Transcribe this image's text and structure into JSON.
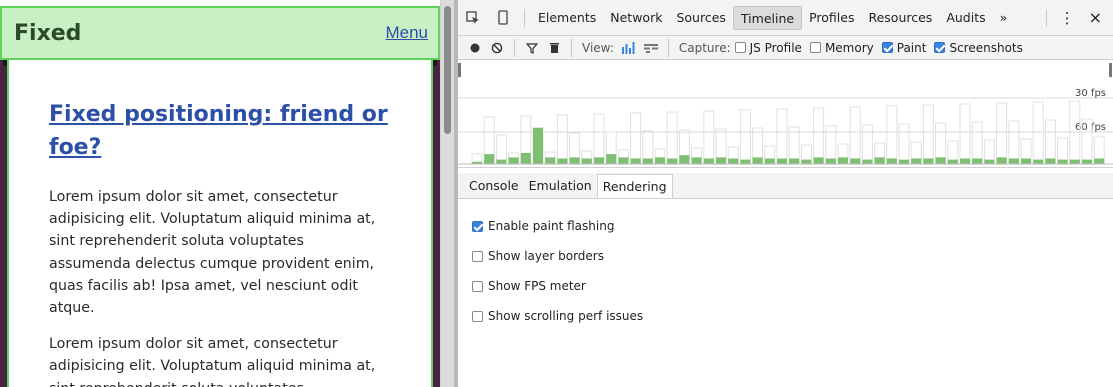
{
  "page": {
    "header_title": "Fixed",
    "menu_label": "Menu",
    "article_title": "Fixed positioning: friend or foe?",
    "paragraphs": [
      "Lorem ipsum dolor sit amet, consectetur\nadipisicing elit. Voluptatum aliquid minima at,\nsint reprehenderit soluta voluptates\nassumenda delectus cumque provident enim,\nquas facilis ab! Ipsa amet, vel nesciunt odit\natque.",
      "Lorem ipsum dolor sit amet, consectetur\nadipisicing elit. Voluptatum aliquid minima at,\nsint reprehenderit soluta voluptates"
    ]
  },
  "devtools": {
    "tabs": [
      "Elements",
      "Network",
      "Sources",
      "Timeline",
      "Profiles",
      "Resources",
      "Audits"
    ],
    "active_tab": "Timeline",
    "more_tabs": "»",
    "menu_dots": "⋮",
    "close": "×",
    "toolbar": {
      "view_label": "View:",
      "capture_label": "Capture:",
      "js_profile": {
        "label": "JS Profile",
        "checked": false
      },
      "memory": {
        "label": "Memory",
        "checked": false
      },
      "paint": {
        "label": "Paint",
        "checked": true
      },
      "screenshots": {
        "label": "Screenshots",
        "checked": true
      }
    },
    "overview": {
      "fps30_label": "30 fps",
      "fps60_label": "60 fps",
      "frames": [
        2,
        9,
        4,
        6,
        10,
        33,
        6,
        5,
        6,
        5,
        6,
        9,
        6,
        5,
        5,
        6,
        5,
        8,
        6,
        5,
        6,
        5,
        4,
        6,
        5,
        5,
        5,
        4,
        6,
        5,
        6,
        5,
        4,
        6,
        5,
        4,
        5,
        5,
        6,
        4,
        5,
        5,
        4,
        6,
        5,
        5,
        4,
        5,
        4,
        4,
        4,
        5
      ],
      "highlight_color": "#7fbf72",
      "bar_color": "#e0e0e0"
    },
    "subtabs": [
      "Console",
      "Emulation",
      "Rendering"
    ],
    "active_subtab": "Rendering",
    "rendering_options": [
      {
        "label": "Enable paint flashing",
        "checked": true
      },
      {
        "label": "Show layer borders",
        "checked": false
      },
      {
        "label": "Show FPS meter",
        "checked": false
      },
      {
        "label": "Show scrolling perf issues",
        "checked": false
      }
    ],
    "accent_color": "#3b82dd"
  }
}
